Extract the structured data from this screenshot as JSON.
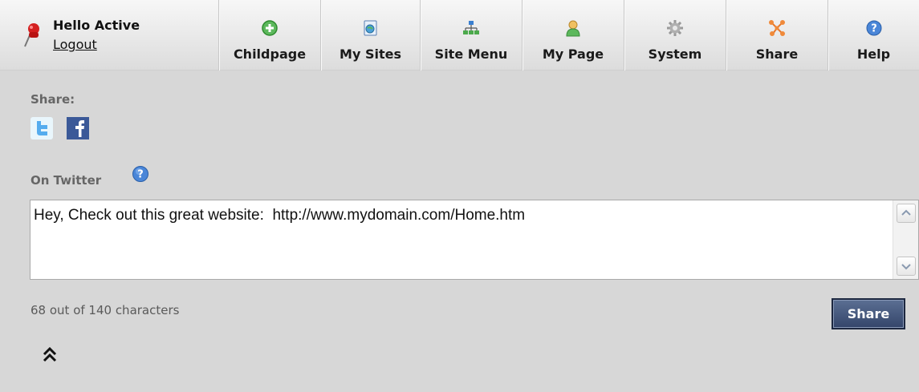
{
  "user": {
    "greeting": "Hello Active",
    "logout_label": "Logout"
  },
  "nav": {
    "items": [
      {
        "label": "Childpage",
        "icon": "add-icon"
      },
      {
        "label": "My Sites",
        "icon": "sites-icon"
      },
      {
        "label": "Site Menu",
        "icon": "sitemap-icon"
      },
      {
        "label": "My Page",
        "icon": "user-icon"
      },
      {
        "label": "System",
        "icon": "gear-icon"
      },
      {
        "label": "Share",
        "icon": "share-icon"
      },
      {
        "label": "Help",
        "icon": "help-icon"
      }
    ]
  },
  "share": {
    "heading": "Share:",
    "networks": [
      "twitter",
      "facebook"
    ]
  },
  "twitter": {
    "heading": "On Twitter",
    "message": "Hey, Check out this great website:  http://www.mydomain.com/Home.htm",
    "char_count": "68 out of 140 characters",
    "share_button": "Share"
  },
  "colors": {
    "background": "#d7d7d7",
    "button": "#3a4b70",
    "twitter": "#55acee",
    "facebook": "#3b5998"
  }
}
